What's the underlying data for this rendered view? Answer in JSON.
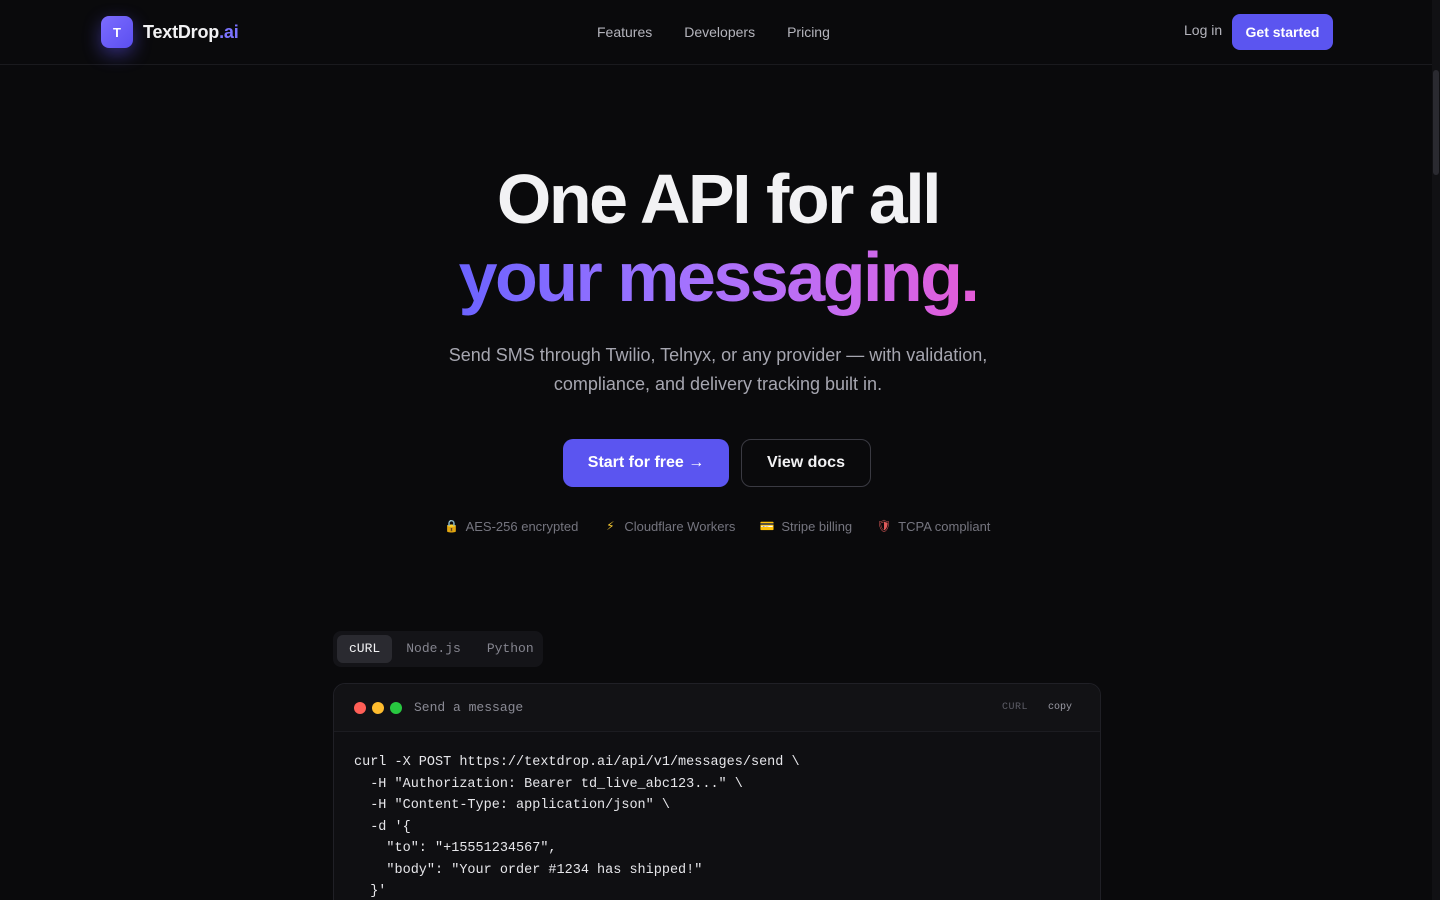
{
  "nav": {
    "logo_letter": "T",
    "logo_name": "TextDrop",
    "logo_tld": ".ai",
    "links": [
      "Features",
      "Developers",
      "Pricing"
    ],
    "login": "Log in",
    "cta": "Get started"
  },
  "hero": {
    "title_line1": "One API for all",
    "title_line2": "your messaging.",
    "subtitle": "Send SMS through Twilio, Telnyx, or any provider — with validation, compliance, and delivery tracking built in.",
    "primary_cta": "Start for free →",
    "secondary_cta": "View docs",
    "badges": [
      {
        "icon": "lock-icon",
        "glyph": "🔒",
        "label": "AES-256 encrypted"
      },
      {
        "icon": "bolt-icon",
        "glyph": "⚡",
        "label": "Cloudflare Workers"
      },
      {
        "icon": "credit-card-icon",
        "glyph": "💳",
        "label": "Stripe billing"
      },
      {
        "icon": "shield-icon",
        "glyph": "🛡",
        "label": "TCPA compliant"
      }
    ]
  },
  "code": {
    "tabs": [
      "cURL",
      "Node.js",
      "Python"
    ],
    "active_tab": "cURL",
    "window_title": "Send a message",
    "language": "CURL",
    "copy_label": "copy",
    "lines": [
      "curl -X POST https://textdrop.ai/api/v1/messages/send \\",
      "  -H \"Authorization: Bearer td_live_abc123...\" \\",
      "  -H \"Content-Type: application/json\" \\",
      "  -d '{",
      "    \"to\": \"+15551234567\",",
      "    \"body\": \"Your order #1234 has shipped!\"",
      "  }'"
    ]
  },
  "colors": {
    "background": "#0a0a0c",
    "accent": "#5b55f0",
    "gradient_start": "#6c63ff",
    "gradient_end": "#e45bd8"
  }
}
